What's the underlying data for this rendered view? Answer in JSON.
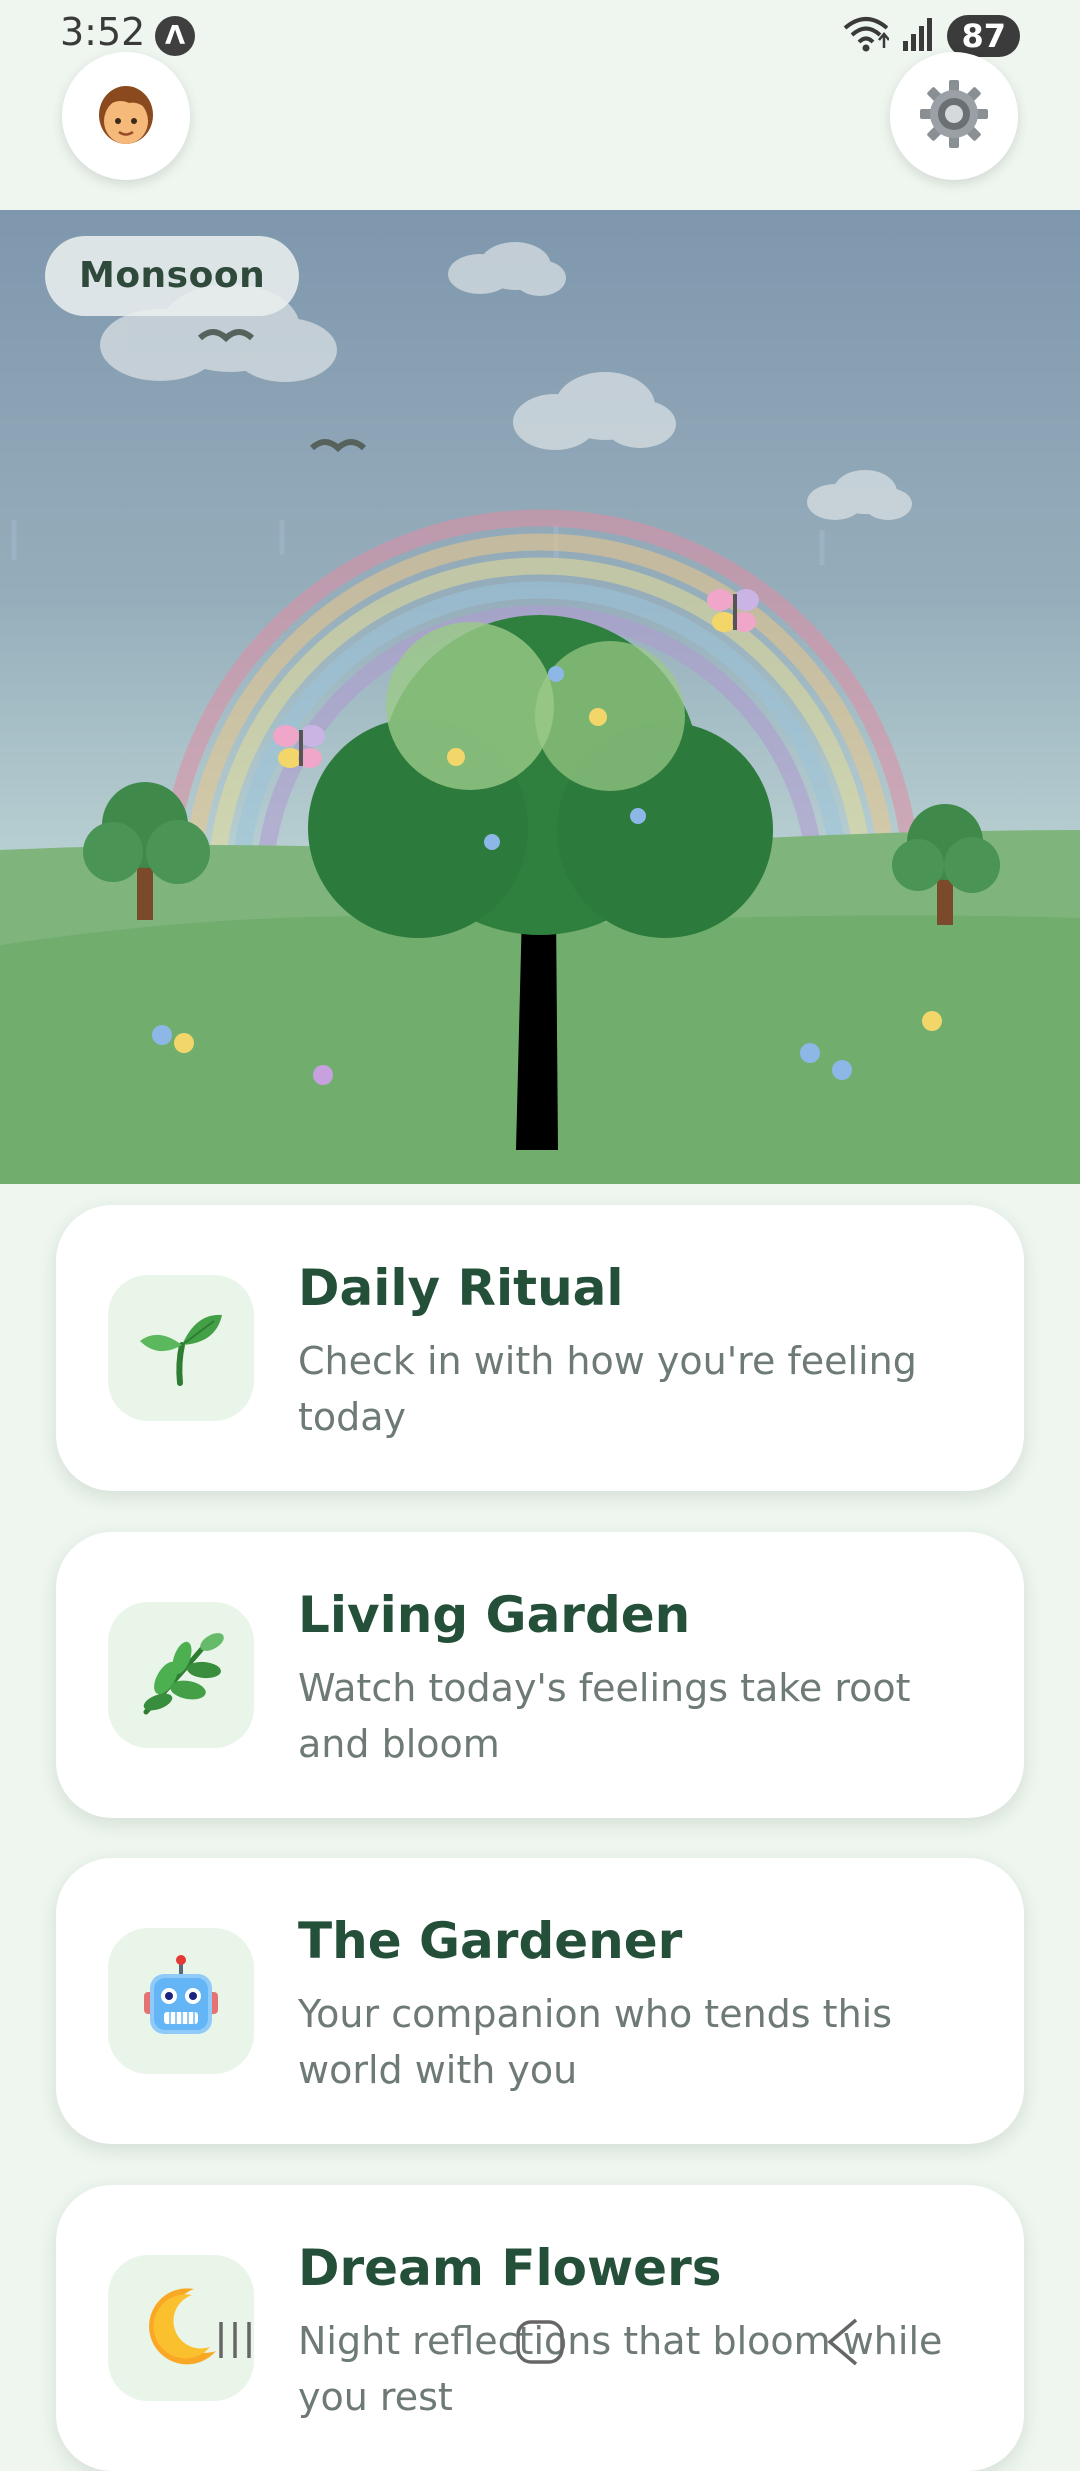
{
  "status_bar": {
    "time": "3:52",
    "notification_glyph": "Λ",
    "battery": "87",
    "icons": [
      "wifi-icon",
      "signal-icon",
      "battery-icon"
    ]
  },
  "header": {
    "avatar_icon": "child-avatar-icon",
    "settings_icon": "gear-icon"
  },
  "garden_scene": {
    "season_label": "Monsoon"
  },
  "cards": [
    {
      "title": "Daily Ritual",
      "description": "Check in with how you're feeling today",
      "icon": "seedling-icon"
    },
    {
      "title": "Living Garden",
      "description": "Watch today's feelings take root and bloom",
      "icon": "herb-icon"
    },
    {
      "title": "The Gardener",
      "description": "Your companion who tends this world with you",
      "icon": "robot-icon"
    },
    {
      "title": "Dream Flowers",
      "description": "Night reflections that bloom while you rest",
      "icon": "crescent-moon-icon"
    }
  ],
  "nav_bar": {
    "buttons": [
      "recent-apps-icon",
      "home-icon",
      "back-icon"
    ]
  },
  "colors": {
    "background": "#eef6ef",
    "title_text": "#24503a",
    "body_text": "#6e7a74",
    "card_icon_bg": "#eaf5ea",
    "grass": "#71ae6e"
  }
}
